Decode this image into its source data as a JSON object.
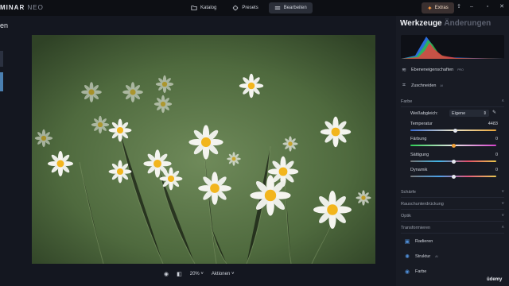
{
  "app": {
    "logo_main": "MINAR",
    "logo_sub": "NEO"
  },
  "tabs": [
    {
      "label": "Katalog",
      "icon": "folder-icon"
    },
    {
      "label": "Presets",
      "icon": "presets-icon"
    },
    {
      "label": "Bearbeiten",
      "icon": "sliders-icon"
    }
  ],
  "extras_label": "Extras",
  "left_panel": {
    "title": "en"
  },
  "bottom_bar": {
    "zoom": "20%",
    "actions": "Aktionen"
  },
  "tools": {
    "title": "Werkzeuge",
    "subtitle": "Änderungen",
    "layer_properties": "Ebeneneigenschaften",
    "layer_badge": "PRO",
    "crop": "Zuschneiden",
    "crop_badge": "AI",
    "section_farbe": "Farbe",
    "white_balance_label": "Weißabgleich:",
    "white_balance_value": "Eigene",
    "sliders": [
      {
        "label": "Temperatur",
        "value": "4483",
        "level": 0.52
      },
      {
        "label": "Färbung",
        "value": "0",
        "level": 0.5
      },
      {
        "label": "Sättigung",
        "value": "0",
        "level": 0.5
      },
      {
        "label": "Dynamik",
        "value": "0",
        "level": 0.5
      }
    ],
    "sections": [
      {
        "label": "Schärfe"
      },
      {
        "label": "Rauschunterdrückung"
      },
      {
        "label": "Optik"
      },
      {
        "label": "Transformieren"
      }
    ],
    "transform_items": [
      {
        "label": "Radieren",
        "badge": ""
      },
      {
        "label": "Struktur",
        "badge": "AI"
      },
      {
        "label": "Farbe",
        "badge": ""
      }
    ]
  },
  "watermark": "ûdemy"
}
